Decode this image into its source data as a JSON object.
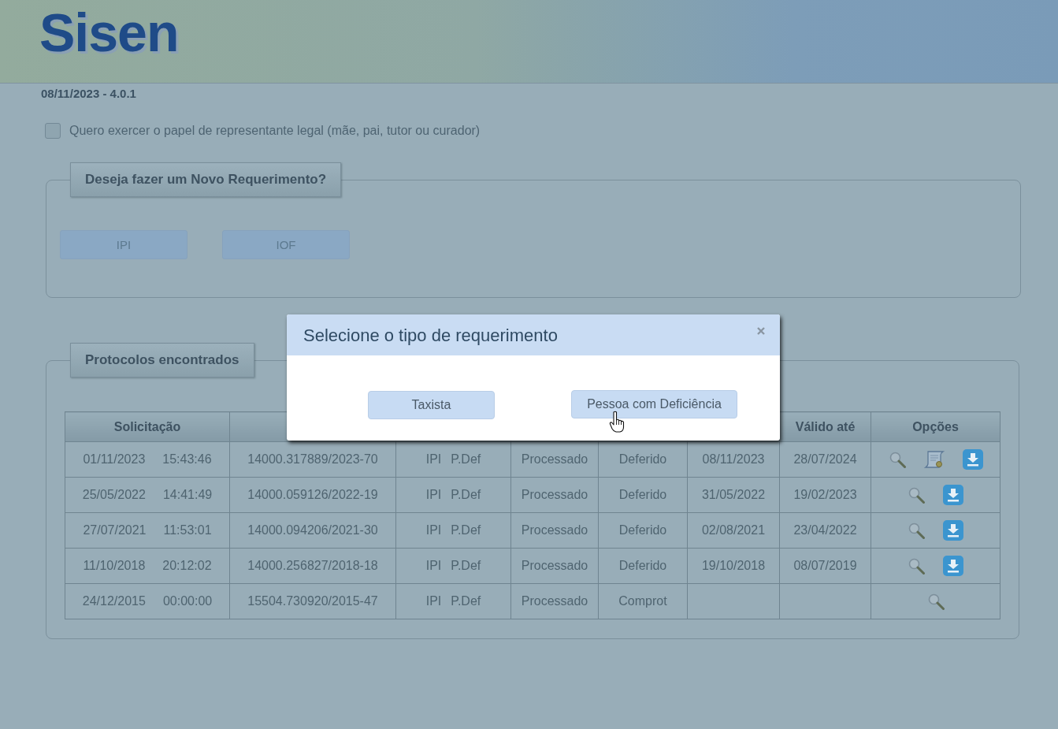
{
  "header": {
    "logo": "Sisen",
    "version": "08/11/2023 - 4.0.1"
  },
  "representative": {
    "label": "Quero exercer o papel de representante legal (mãe, pai, tutor ou curador)",
    "checked": false
  },
  "new_request": {
    "legend": "Deseja fazer um Novo Requerimento?",
    "buttons": [
      "IPI",
      "IOF"
    ]
  },
  "protocols": {
    "legend": "Protocolos encontrados",
    "columns": [
      {
        "label": "Solicitação"
      },
      {},
      {},
      {},
      {},
      {},
      {
        "label": "Válido até"
      },
      {
        "label": "Opções"
      }
    ],
    "rows": [
      {
        "date": "01/11/2023",
        "time": "15:43:46",
        "protocol": "14000.317889/2023-70",
        "tax": "IPI",
        "type": "P.Def",
        "status": "Processado",
        "result": "Deferido",
        "column_6": "08/11/2023",
        "valid_until": "28/07/2024",
        "actions": [
          {
            "kind": "view"
          },
          {
            "kind": "certificate"
          },
          {
            "kind": "download"
          }
        ]
      },
      {
        "date": "25/05/2022",
        "time": "14:41:49",
        "protocol": "14000.059126/2022-19",
        "tax": "IPI",
        "type": "P.Def",
        "status": "Processado",
        "result": "Deferido",
        "column_6": "31/05/2022",
        "valid_until": "19/02/2023",
        "actions": [
          {
            "kind": "view"
          },
          {
            "kind": "download"
          }
        ]
      },
      {
        "date": "27/07/2021",
        "time": "11:53:01",
        "protocol": "14000.094206/2021-30",
        "tax": "IPI",
        "type": "P.Def",
        "status": "Processado",
        "result": "Deferido",
        "column_6": "02/08/2021",
        "valid_until": "23/04/2022",
        "actions": [
          {
            "kind": "view"
          },
          {
            "kind": "download"
          }
        ]
      },
      {
        "date": "11/10/2018",
        "time": "20:12:02",
        "protocol": "14000.256827/2018-18",
        "tax": "IPI",
        "type": "P.Def",
        "status": "Processado",
        "result": "Deferido",
        "column_6": "19/10/2018",
        "valid_until": "08/07/2019",
        "actions": [
          {
            "kind": "view"
          },
          {
            "kind": "download"
          }
        ]
      },
      {
        "date": "24/12/2015",
        "time": "00:00:00",
        "protocol": "15504.730920/2015-47",
        "tax": "IPI",
        "type": "P.Def",
        "status": "Processado",
        "result": "Comprot",
        "actions": [
          {
            "kind": "view"
          }
        ]
      }
    ]
  },
  "dialog": {
    "title": "Selecione o tipo de requerimento",
    "buttons": [
      "Taxista",
      "Pessoa com Deficiência"
    ]
  }
}
